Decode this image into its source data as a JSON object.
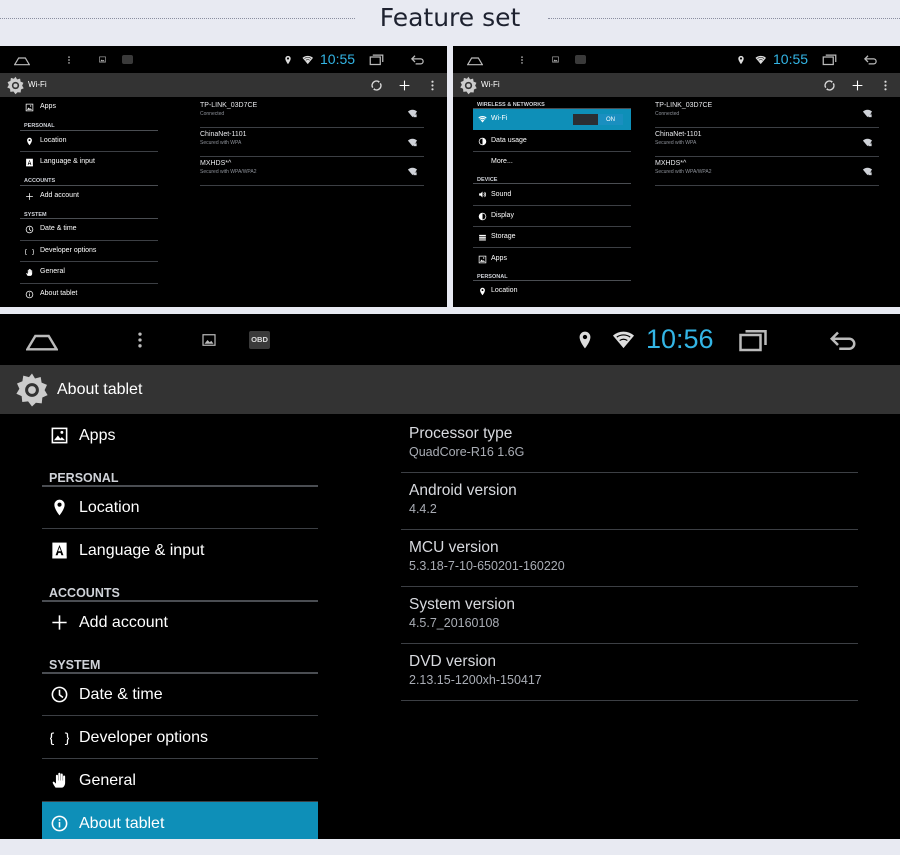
{
  "page_title": "Feature set",
  "small_left": {
    "status_bar": {
      "time": "10:55",
      "icons": [
        "home-icon",
        "menu-dots-icon",
        "gallery-icon",
        "obd-icon",
        "location-icon",
        "wifi-icon",
        "recents-icon",
        "back-icon"
      ]
    },
    "action_bar": {
      "title": "Wi-Fi",
      "icons": [
        "settings-gear-icon",
        "wps-icon",
        "add-icon",
        "overflow-icon"
      ]
    },
    "sidebar": [
      {
        "type": "item",
        "label": "Apps",
        "icon": "apps-icon"
      },
      {
        "type": "header",
        "label": "PERSONAL"
      },
      {
        "type": "item",
        "label": "Location",
        "icon": "location-icon"
      },
      {
        "type": "item",
        "label": "Language & input",
        "icon": "language-icon"
      },
      {
        "type": "header",
        "label": "ACCOUNTS"
      },
      {
        "type": "item",
        "label": "Add account",
        "icon": "add-icon"
      },
      {
        "type": "header",
        "label": "SYSTEM"
      },
      {
        "type": "item",
        "label": "Date & time",
        "icon": "clock-icon"
      },
      {
        "type": "item",
        "label": "Developer options",
        "icon": "braces-icon"
      },
      {
        "type": "item",
        "label": "General",
        "icon": "hand-icon"
      },
      {
        "type": "item",
        "label": "About tablet",
        "icon": "info-icon"
      }
    ],
    "networks": [
      {
        "ssid": "TP-LINK_03D7CE",
        "status": "Connected"
      },
      {
        "ssid": "ChinaNet-1101",
        "status": "Secured with WPA"
      },
      {
        "ssid": "MXHDS*^",
        "status": "Secured with WPA/WPA2"
      }
    ]
  },
  "small_right": {
    "status_bar": {
      "time": "10:55"
    },
    "action_bar": {
      "title": "Wi-Fi"
    },
    "sidebar": [
      {
        "type": "header",
        "label": "WIRELESS & NETWORKS"
      },
      {
        "type": "item",
        "label": "Wi-Fi",
        "icon": "wifi-icon",
        "selected": true,
        "toggle": "ON"
      },
      {
        "type": "item",
        "label": "Data usage",
        "icon": "data-usage-icon"
      },
      {
        "type": "item",
        "label": "More...",
        "icon": ""
      },
      {
        "type": "header",
        "label": "DEVICE"
      },
      {
        "type": "item",
        "label": "Sound",
        "icon": "sound-icon"
      },
      {
        "type": "item",
        "label": "Display",
        "icon": "display-icon"
      },
      {
        "type": "item",
        "label": "Storage",
        "icon": "storage-icon"
      },
      {
        "type": "item",
        "label": "Apps",
        "icon": "apps-icon"
      },
      {
        "type": "header",
        "label": "PERSONAL"
      },
      {
        "type": "item",
        "label": "Location",
        "icon": "location-icon"
      }
    ],
    "networks": [
      {
        "ssid": "TP-LINK_03D7CE",
        "status": "Connected"
      },
      {
        "ssid": "ChinaNet-1101",
        "status": "Secured with WPA"
      },
      {
        "ssid": "MXHDS*^",
        "status": "Secured with WPA/WPA2"
      }
    ]
  },
  "large": {
    "status_bar": {
      "time": "10:56",
      "obd_label": "OBD"
    },
    "action_bar": {
      "title": "About tablet"
    },
    "sidebar": [
      {
        "type": "item",
        "label": "Apps",
        "icon": "apps-icon"
      },
      {
        "type": "header",
        "label": "PERSONAL"
      },
      {
        "type": "item",
        "label": "Location",
        "icon": "location-icon"
      },
      {
        "type": "item",
        "label": "Language & input",
        "icon": "language-icon"
      },
      {
        "type": "header",
        "label": "ACCOUNTS"
      },
      {
        "type": "item",
        "label": "Add account",
        "icon": "add-icon"
      },
      {
        "type": "header",
        "label": "SYSTEM"
      },
      {
        "type": "item",
        "label": "Date & time",
        "icon": "clock-icon"
      },
      {
        "type": "item",
        "label": "Developer options",
        "icon": "braces-icon"
      },
      {
        "type": "item",
        "label": "General",
        "icon": "hand-icon"
      },
      {
        "type": "item",
        "label": "About tablet",
        "icon": "info-icon",
        "selected": true
      }
    ],
    "info": [
      {
        "title": "Processor type",
        "value": "QuadCore-R16 1.6G"
      },
      {
        "title": "Android version",
        "value": "4.4.2"
      },
      {
        "title": "MCU version",
        "value": "5.3.18-7-10-650201-160220"
      },
      {
        "title": "System version",
        "value": "4.5.7_20160108"
      },
      {
        "title": "DVD version",
        "value": "2.13.15-1200xh-150417"
      }
    ]
  },
  "colors": {
    "accent": "#33b5e5",
    "selected": "#0e8fb8",
    "action_bar": "#333333",
    "screen_bg": "#000000",
    "page_bg": "#e8eaf2"
  }
}
